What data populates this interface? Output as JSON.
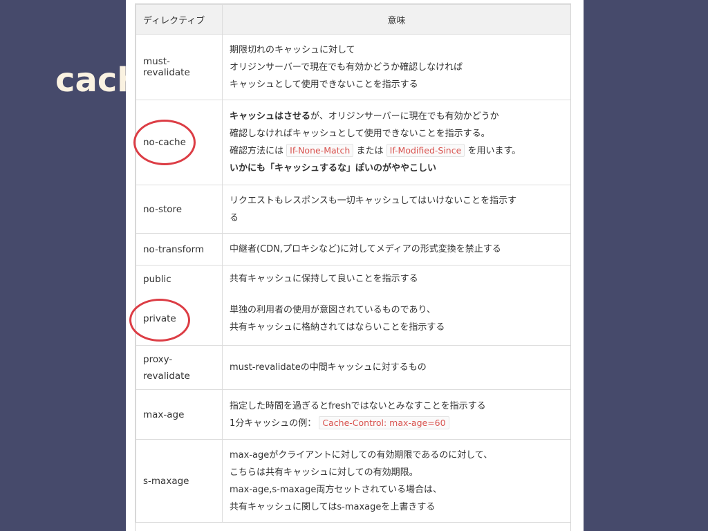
{
  "slide": {
    "title": "cach"
  },
  "table": {
    "headers": {
      "directive": "ディレクティブ",
      "meaning": "意味"
    },
    "rows": [
      {
        "directive": "must-revalidate",
        "lines": [
          "期限切れのキャッシュに対して",
          "オリジンサーバーで現在でも有効かどうか確認しなければ",
          "キャッシュとして使用できないことを指示する"
        ]
      },
      {
        "directive": "no-cache",
        "line1_bold": "キャッシュはさせる",
        "line1_rest": "が、オリジンサーバーに現在でも有効かどうか",
        "line2": "確認しなければキャッシュとして使用できないことを指示する。",
        "line3_pre": "確認方法には",
        "code1": "If-None-Match",
        "line3_mid": "または",
        "code2": "If-Modified-Since",
        "line3_post": "を用います。",
        "line4_bold": "いかにも「キャッシュするな」ぽいのがややこしい"
      },
      {
        "directive": "no-store",
        "lines": [
          "リクエストもレスポンスも一切キャッシュしてはいけないことを指示す",
          "る"
        ]
      },
      {
        "directive": "no-transform",
        "lines": [
          "中継者(CDN,プロキシなど)に対してメディアの形式変換を禁止する"
        ]
      },
      {
        "directive": "public",
        "lines": [
          "共有キャッシュに保持して良いことを指示する"
        ]
      },
      {
        "directive": "private",
        "lines": [
          "単独の利用者の使用が意図されているものであり、",
          "共有キャッシュに格納されてはならいことを指示する"
        ]
      },
      {
        "directive_line1": "proxy-",
        "directive_line2": "revalidate",
        "lines": [
          "must-revalidateの中間キャッシュに対するもの"
        ]
      },
      {
        "directive": "max-age",
        "line1": "指定した時間を過ぎるとfreshではないとみなすことを指示する",
        "line2_pre": "1分キャッシュの例：",
        "code": "Cache-Control: max-age=60"
      },
      {
        "directive": "s-maxage",
        "lines": [
          "max-ageがクライアントに対しての有効期限であるのに対して、",
          "こちらは共有キャッシュに対しての有効期限。",
          "max-age,s-maxage両方セットされている場合は、",
          "共有キャッシュに関してはs-maxageを上書きする"
        ]
      }
    ]
  },
  "annotations": {
    "circle_color": "#dc3d45",
    "circled": [
      "no-cache",
      "private"
    ]
  }
}
